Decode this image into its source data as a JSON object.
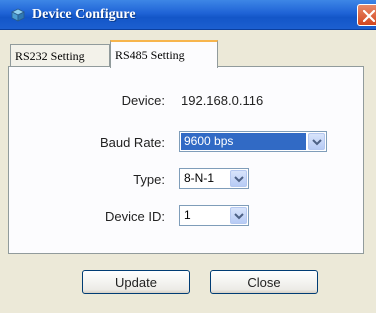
{
  "window": {
    "title": "Device Configure"
  },
  "tabs": [
    {
      "label": "RS232 Setting",
      "active": false
    },
    {
      "label": "RS485 Setting",
      "active": true
    }
  ],
  "form": {
    "device_label": "Device:",
    "device_value": "192.168.0.116",
    "baud_label": "Baud Rate:",
    "baud_value": "9600 bps",
    "type_label": "Type:",
    "type_value": "8-N-1",
    "device_id_label": "Device ID:",
    "device_id_value": "1"
  },
  "buttons": {
    "update_label": "Update",
    "close_label": "Close"
  },
  "colors": {
    "titlebar": "#1f63d6",
    "selection": "#316ac5",
    "close_button": "#d3461f"
  },
  "icons": {
    "title": "device-configure-icon",
    "close": "close-icon",
    "dropdown": "chevron-down-icon"
  }
}
